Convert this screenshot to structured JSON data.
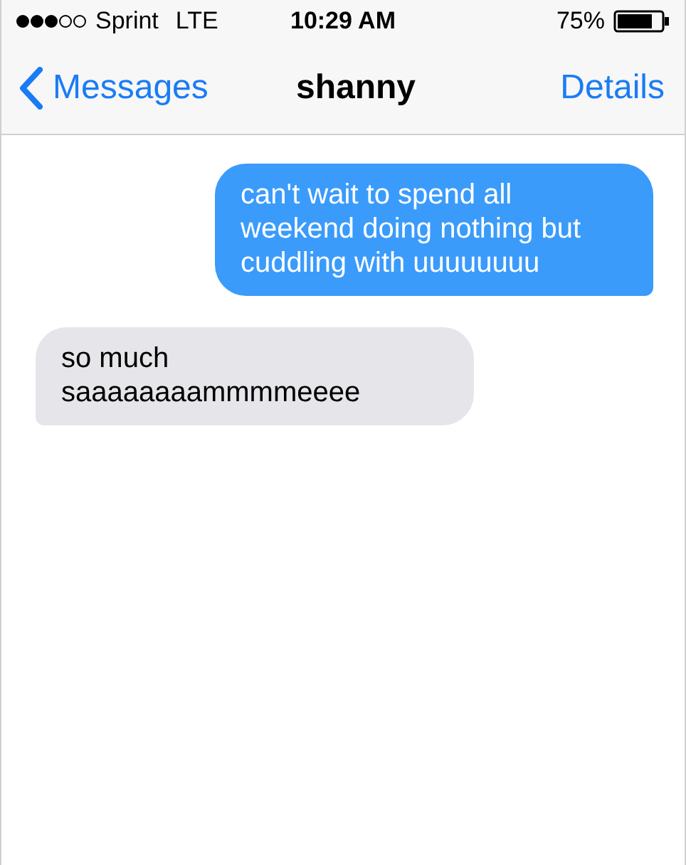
{
  "status_bar": {
    "carrier": "Sprint",
    "network": "LTE",
    "time": "10:29 AM",
    "battery": "75%"
  },
  "nav_bar": {
    "back": "Messages",
    "title": "shanny",
    "action": "Details"
  },
  "messages": [
    {
      "kind": "sent",
      "text": "can't wait to spend all weekend doing nothing but cuddling with uuuuuuuu"
    },
    {
      "kind": "received",
      "text": "so much saaaaaaaammmmeeee"
    }
  ]
}
